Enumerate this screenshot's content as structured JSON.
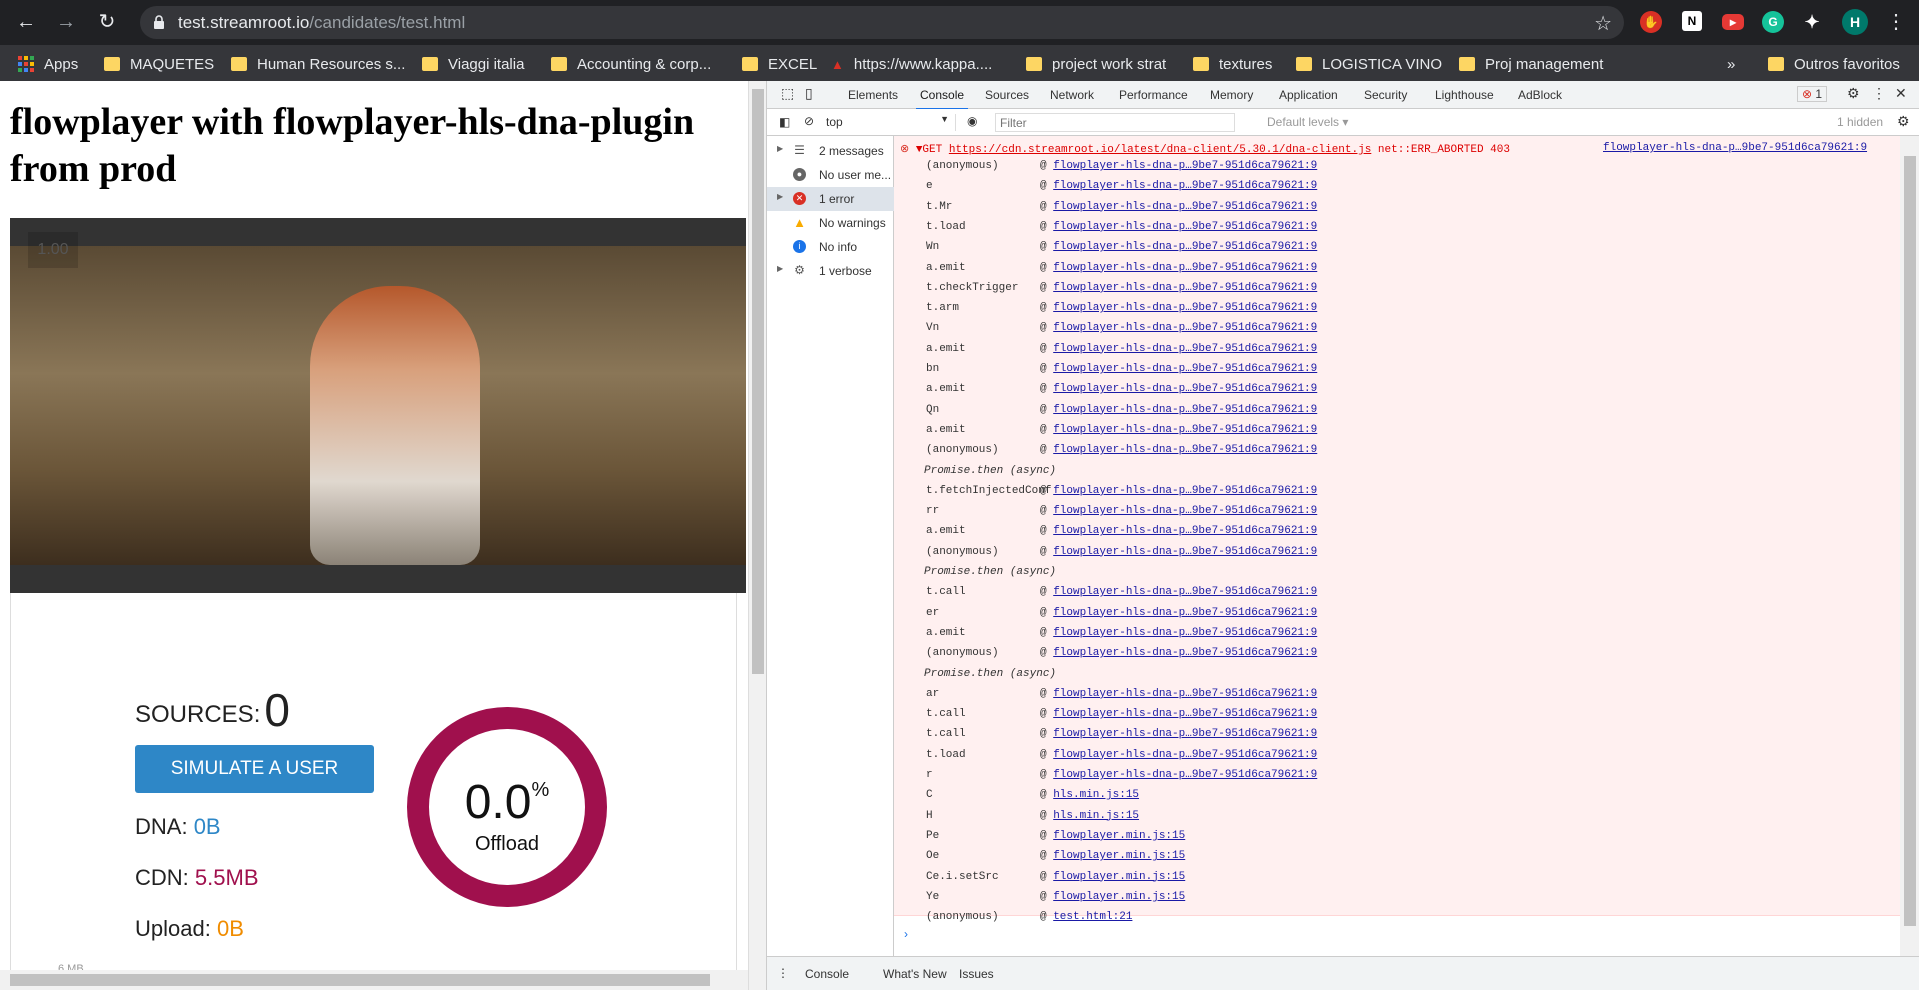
{
  "browser": {
    "url_host": "test.streamroot.io",
    "url_path": "/candidates/test.html",
    "profile_initial": "H",
    "ext_g": "G"
  },
  "bookmarks": [
    "Apps",
    "MAQUETES",
    "Human Resources s...",
    "Viaggi italia",
    "Accounting & corp...",
    "EXCEL",
    "https://www.kappa....",
    "project work strat",
    "textures",
    "LOGISTICA VINO",
    "Proj management"
  ],
  "bookmarks_more": "»",
  "bookmarks_other": "Outros favoritos",
  "page": {
    "title": "flowplayer with flowplayer-hls-dna-plugin from prod",
    "playback_rate": "1.00",
    "sources_label": "SOURCES:",
    "sources_value": "0",
    "simulate_label": "SIMULATE A USER",
    "dna_label": "DNA:",
    "dna_value": "0B",
    "dna_color": "#2e87c7",
    "cdn_label": "CDN:",
    "cdn_value": "5.5MB",
    "cdn_color": "#a0104d",
    "upload_label": "Upload:",
    "upload_value": "0B",
    "upload_color": "#f08c00",
    "offload_pct": "0.0",
    "offload_unit": "%",
    "offload_label": "Offload",
    "partial_text": "6 MB"
  },
  "devtools": {
    "tabs": [
      "Elements",
      "Console",
      "Sources",
      "Network",
      "Performance",
      "Memory",
      "Application",
      "Security",
      "Lighthouse",
      "AdBlock"
    ],
    "active_tab": "Console",
    "error_count": "1",
    "context": "top",
    "filter_placeholder": "Filter",
    "levels": "Default levels ▾",
    "hidden": "1 hidden",
    "sidebar": [
      {
        "label": "2 messages",
        "icon": "list-icon"
      },
      {
        "label": "No user me...",
        "icon": "user-icon"
      },
      {
        "label": "1 error",
        "icon": "error-icon"
      },
      {
        "label": "No warnings",
        "icon": "warning-icon"
      },
      {
        "label": "No info",
        "icon": "info-icon"
      },
      {
        "label": "1 verbose",
        "icon": "gear-icon"
      }
    ],
    "error": {
      "method": "▼GET",
      "url": "https://cdn.streamroot.io/latest/dna-client/5.30.1/dna-client.js",
      "status": "net::ERR_ABORTED 403",
      "source": "flowplayer-hls-dna-p…9be7-951d6ca79621:9"
    },
    "stack": [
      {
        "fn": "(anonymous)",
        "src": "flowplayer-hls-dna-p…9be7-951d6ca79621:9"
      },
      {
        "fn": "e",
        "src": "flowplayer-hls-dna-p…9be7-951d6ca79621:9"
      },
      {
        "fn": "t.Mr",
        "src": "flowplayer-hls-dna-p…9be7-951d6ca79621:9"
      },
      {
        "fn": "t.load",
        "src": "flowplayer-hls-dna-p…9be7-951d6ca79621:9"
      },
      {
        "fn": "Wn",
        "src": "flowplayer-hls-dna-p…9be7-951d6ca79621:9"
      },
      {
        "fn": "a.emit",
        "src": "flowplayer-hls-dna-p…9be7-951d6ca79621:9"
      },
      {
        "fn": "t.checkTrigger",
        "src": "flowplayer-hls-dna-p…9be7-951d6ca79621:9"
      },
      {
        "fn": "t.arm",
        "src": "flowplayer-hls-dna-p…9be7-951d6ca79621:9"
      },
      {
        "fn": "Vn",
        "src": "flowplayer-hls-dna-p…9be7-951d6ca79621:9"
      },
      {
        "fn": "a.emit",
        "src": "flowplayer-hls-dna-p…9be7-951d6ca79621:9"
      },
      {
        "fn": "bn",
        "src": "flowplayer-hls-dna-p…9be7-951d6ca79621:9"
      },
      {
        "fn": "a.emit",
        "src": "flowplayer-hls-dna-p…9be7-951d6ca79621:9"
      },
      {
        "fn": "Qn",
        "src": "flowplayer-hls-dna-p…9be7-951d6ca79621:9"
      },
      {
        "fn": "a.emit",
        "src": "flowplayer-hls-dna-p…9be7-951d6ca79621:9"
      },
      {
        "fn": "(anonymous)",
        "src": "flowplayer-hls-dna-p…9be7-951d6ca79621:9"
      },
      {
        "async": "Promise.then (async)"
      },
      {
        "fn": "t.fetchInjectedConf",
        "src": "flowplayer-hls-dna-p…9be7-951d6ca79621:9"
      },
      {
        "fn": "rr",
        "src": "flowplayer-hls-dna-p…9be7-951d6ca79621:9"
      },
      {
        "fn": "a.emit",
        "src": "flowplayer-hls-dna-p…9be7-951d6ca79621:9"
      },
      {
        "fn": "(anonymous)",
        "src": "flowplayer-hls-dna-p…9be7-951d6ca79621:9"
      },
      {
        "async": "Promise.then (async)"
      },
      {
        "fn": "t.call",
        "src": "flowplayer-hls-dna-p…9be7-951d6ca79621:9"
      },
      {
        "fn": "er",
        "src": "flowplayer-hls-dna-p…9be7-951d6ca79621:9"
      },
      {
        "fn": "a.emit",
        "src": "flowplayer-hls-dna-p…9be7-951d6ca79621:9"
      },
      {
        "fn": "(anonymous)",
        "src": "flowplayer-hls-dna-p…9be7-951d6ca79621:9"
      },
      {
        "async": "Promise.then (async)"
      },
      {
        "fn": "ar",
        "src": "flowplayer-hls-dna-p…9be7-951d6ca79621:9"
      },
      {
        "fn": "t.call",
        "src": "flowplayer-hls-dna-p…9be7-951d6ca79621:9"
      },
      {
        "fn": "t.call",
        "src": "flowplayer-hls-dna-p…9be7-951d6ca79621:9"
      },
      {
        "fn": "t.load",
        "src": "flowplayer-hls-dna-p…9be7-951d6ca79621:9"
      },
      {
        "fn": "r",
        "src": "flowplayer-hls-dna-p…9be7-951d6ca79621:9"
      },
      {
        "fn": "C",
        "src": "hls.min.js:15"
      },
      {
        "fn": "H",
        "src": "hls.min.js:15"
      },
      {
        "fn": "Pe",
        "src": "flowplayer.min.js:15"
      },
      {
        "fn": "Oe",
        "src": "flowplayer.min.js:15"
      },
      {
        "fn": "Ce.i.setSrc",
        "src": "flowplayer.min.js:15"
      },
      {
        "fn": "Ye",
        "src": "flowplayer.min.js:15"
      },
      {
        "fn": "(anonymous)",
        "src": "test.html:21"
      }
    ],
    "drawer_tabs": [
      "Console",
      "What's New",
      "Issues"
    ]
  }
}
